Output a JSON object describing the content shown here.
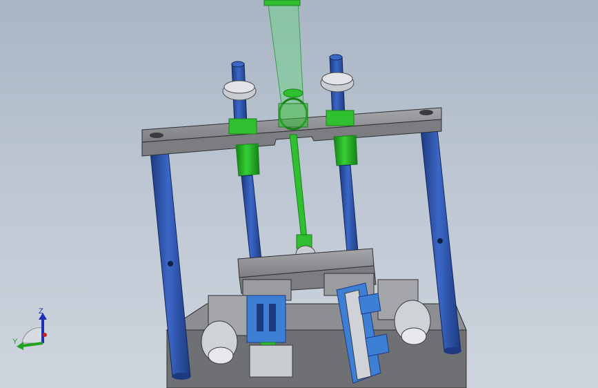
{
  "view": {
    "background_top": "#a9b5c4",
    "background_bottom": "#ced5de"
  },
  "colors": {
    "frame_gray": "#8f9091",
    "frame_dark": "#5f6063",
    "column_blue": "#2f58b3",
    "column_blue_dark": "#1d3a80",
    "cylinder_green": "#2fbf2f",
    "cylinder_green_dark": "#1c7f1c",
    "transparent_green": "#6fd08a",
    "part_light": "#cfd3d8",
    "part_blue": "#3e7fd6"
  },
  "triad": {
    "z_label": "Z",
    "y_label": "Y",
    "z_color": "#1f2fb3",
    "y_color": "#1fa31f",
    "x_color": "#cc2020"
  }
}
